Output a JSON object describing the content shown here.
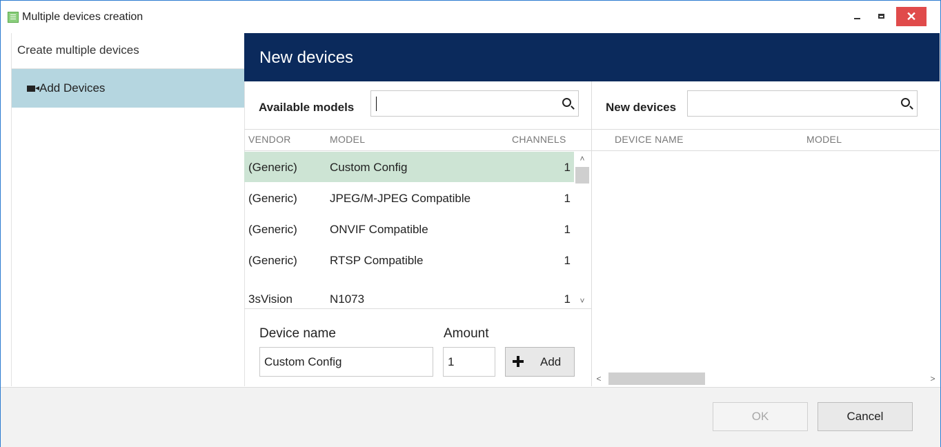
{
  "window": {
    "title": "Multiple devices creation",
    "controls": {
      "minimize": "minimize",
      "maximize": "maximize",
      "close": "✕"
    }
  },
  "sidebar": {
    "heading": "Create multiple devices",
    "items": [
      {
        "label": "Add Devices",
        "icon": "video-camera-icon",
        "selected": true
      }
    ]
  },
  "header": {
    "title": "New devices"
  },
  "available": {
    "label": "Available models",
    "search_value": "",
    "columns": {
      "vendor": "VENDOR",
      "model": "MODEL",
      "channels": "CHANNELS"
    },
    "rows": [
      {
        "vendor": "(Generic)",
        "model": "Custom Config",
        "channels": "1",
        "selected": true
      },
      {
        "vendor": "(Generic)",
        "model": "JPEG/M-JPEG Compatible",
        "channels": "1"
      },
      {
        "vendor": "(Generic)",
        "model": "ONVIF Compatible",
        "channels": "1"
      },
      {
        "vendor": "(Generic)",
        "model": "RTSP Compatible",
        "channels": "1"
      },
      {
        "vendor": "3sVision",
        "model": "N1073",
        "channels": "1"
      }
    ]
  },
  "new_devices": {
    "label": "New devices",
    "search_value": "",
    "columns": {
      "device_name": "DEVICE NAME",
      "model": "MODEL"
    },
    "rows": []
  },
  "form": {
    "device_name_label": "Device name",
    "device_name_value": "Custom Config",
    "amount_label": "Amount",
    "amount_value": "1",
    "add_label": "Add"
  },
  "footer": {
    "ok_label": "OK",
    "cancel_label": "Cancel",
    "ok_enabled": false
  },
  "colors": {
    "header_bg": "#0b2a5c",
    "sidebar_selected": "#b5d6e0",
    "row_selected": "#cde4d4",
    "close_button": "#e04b4b"
  }
}
